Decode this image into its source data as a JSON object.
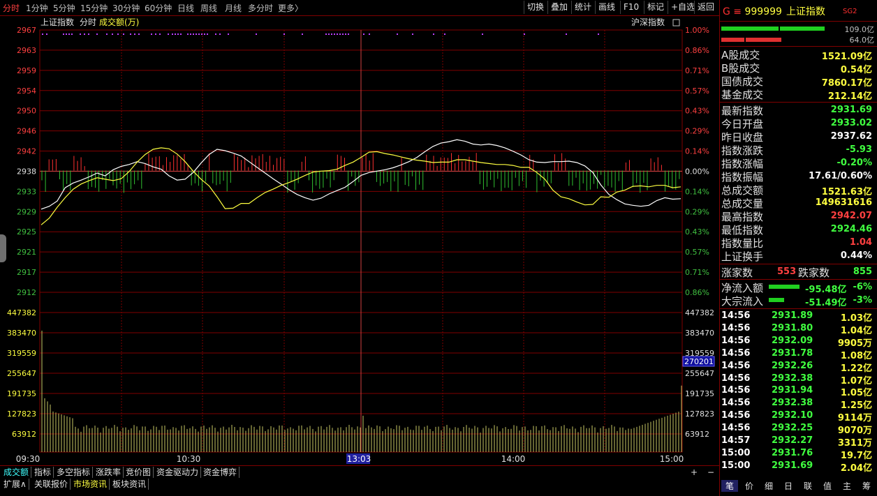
{
  "toolbar": {
    "periods": [
      "分时",
      "1分钟",
      "5分钟",
      "15分钟",
      "30分钟",
      "60分钟",
      "日线",
      "周线",
      "月线",
      "多分时",
      "更多〉"
    ],
    "buttons": [
      "切换",
      "叠加",
      "统计",
      "画线",
      "F10",
      "标记",
      "+自选",
      "返回"
    ]
  },
  "chart_labels": {
    "index_name": "上证指数",
    "mode": "分时",
    "volume_unit": "成交额(万)",
    "overlay": "沪深指数"
  },
  "chart_data": {
    "type": "line",
    "price_ticks": [
      "2967",
      "2963",
      "2959",
      "2954",
      "2950",
      "2946",
      "2942",
      "2938",
      "2933",
      "2929",
      "2925",
      "2921",
      "2917",
      "2912"
    ],
    "pct_ticks": [
      "1.00%",
      "0.86%",
      "0.71%",
      "0.57%",
      "0.43%",
      "0.29%",
      "0.14%",
      "0.00%",
      "0.14%",
      "0.29%",
      "0.43%",
      "0.57%",
      "0.71%",
      "0.86%"
    ],
    "ylim": [
      2912.0,
      2967.2
    ],
    "prev_close": 2937.62,
    "volume_ticks": [
      "447382",
      "383470",
      "319559",
      "255647",
      "191735",
      "127823",
      "63912"
    ],
    "volume_ylim": [
      0,
      447382
    ],
    "x_ticks": [
      "09:30",
      "10:30",
      "13:03",
      "14:00",
      "15:00"
    ],
    "cursor_volume": "270201",
    "series": [
      {
        "values": [
          2929.5,
          2930.1,
          2931.2,
          2934,
          2935,
          2935.6,
          2936.3,
          2937.1,
          2936.5,
          2937.8,
          2938.5,
          2938.9,
          2939.5,
          2939.1,
          2938.4,
          2937.9,
          2936.5,
          2935.6,
          2935.8,
          2937.2,
          2939.2,
          2941,
          2942.1,
          2941.8,
          2941.3,
          2940.7,
          2939.5,
          2938.3,
          2937.1,
          2935.9,
          2934.8,
          2933.6,
          2932.6,
          2931.9,
          2931.4,
          2931.8,
          2932.7,
          2933.4,
          2934.1,
          2935.3,
          2936.6,
          2937.2,
          2937.5,
          2937.8,
          2938.2,
          2938.8,
          2939.5,
          2940.4,
          2941.6,
          2942.7,
          2943.4,
          2943.7,
          2944.1,
          2943.8,
          2943.2,
          2943,
          2943.2,
          2942.9,
          2942.4,
          2941.7,
          2940.9,
          2939.9,
          2939.4,
          2939.3,
          2939.5,
          2939.5,
          2939.6,
          2939.3,
          2938.6,
          2937.2,
          2934.6,
          2932.6,
          2931.5,
          2930.6,
          2930.3,
          2930.1,
          2930.3,
          2931.3,
          2931.9,
          2931.6,
          2931.7
        ]
      },
      {
        "values": [
          2926.2,
          2927.6,
          2929.9,
          2931.9,
          2933.7,
          2934.8,
          2935.5,
          2936.1,
          2935.8,
          2935.5,
          2935.9,
          2937.4,
          2939.4,
          2941,
          2942.1,
          2942.4,
          2942.2,
          2941.1,
          2939.5,
          2937.5,
          2935.8,
          2934.4,
          2932.1,
          2929.6,
          2929.7,
          2930.7,
          2930.7,
          2931.9,
          2933,
          2933.7,
          2934.5,
          2935.1,
          2935.8,
          2936.6,
          2937.3,
          2937.5,
          2937.6,
          2937.9,
          2938.7,
          2939.4,
          2940.4,
          2941.5,
          2941.6,
          2941.2,
          2940.9,
          2940.5,
          2940.1,
          2939.8,
          2939.6,
          2939.3,
          2939.4,
          2939.4,
          2939.9,
          2939.9,
          2939.6,
          2939.3,
          2939.1,
          2938.9,
          2938.9,
          2938.7,
          2938.3,
          2938.3,
          2937.2,
          2935.8,
          2933.5,
          2932.1,
          2931.7,
          2931,
          2930.4,
          2930.5,
          2932.1,
          2932,
          2933.1,
          2933.5,
          2934.3,
          2934.4,
          2934.2,
          2934.5,
          2934.5,
          2934,
          2934.2
        ]
      }
    ]
  },
  "right_panel": {
    "symbol_prefix": "G ≡",
    "code": "999999",
    "name": "上证指数",
    "tag": "SG2",
    "bar_value_1": "109.0亿",
    "bar_value_2": "64.0亿",
    "rows1": [
      {
        "label": "A股成交",
        "value": "1521.09亿"
      },
      {
        "label": "B股成交",
        "value": "0.54亿"
      },
      {
        "label": "国债成交",
        "value": "7860.17亿"
      },
      {
        "label": "基金成交",
        "value": "212.14亿"
      }
    ],
    "rows2": [
      {
        "label": "最新指数",
        "value": "2931.69",
        "color": "#40ff40"
      },
      {
        "label": "今日开盘",
        "value": "2933.02",
        "color": "#40ff40"
      },
      {
        "label": "昨日收盘",
        "value": "2937.62",
        "color": "#ffffff"
      },
      {
        "label": "指数涨跌",
        "value": "-5.93",
        "color": "#40ff40"
      },
      {
        "label": "指数涨幅",
        "value": "-0.20%",
        "color": "#40ff40"
      },
      {
        "label": "指数振幅",
        "value": "17.61/0.60%",
        "color": "#ffffff"
      },
      {
        "label": "总成交额",
        "value": "1521.63亿",
        "color": "#ffff40"
      },
      {
        "label": "总成交量",
        "value": "149631616",
        "color": "#ffff40"
      },
      {
        "label": "最高指数",
        "value": "2942.07",
        "color": "#ff4040"
      },
      {
        "label": "最低指数",
        "value": "2924.46",
        "color": "#40ff40"
      },
      {
        "label": "指数量比",
        "value": "1.04",
        "color": "#ff4040"
      },
      {
        "label": "上证换手",
        "value": "0.44%",
        "color": "#ffffff"
      }
    ],
    "advance_label": "涨家数",
    "advance_value": "553",
    "decline_label": "跌家数",
    "decline_value": "855",
    "flows": [
      {
        "label": "净流入额",
        "value": "-95.48亿",
        "pct": "-6%"
      },
      {
        "label": "大宗流入",
        "value": "-51.49亿",
        "pct": "-3%"
      }
    ],
    "ticks": [
      {
        "time": "14:56",
        "price": "2931.89",
        "amount": "1.03亿"
      },
      {
        "time": "14:56",
        "price": "2931.80",
        "amount": "1.04亿"
      },
      {
        "time": "14:56",
        "price": "2932.09",
        "amount": "9905万"
      },
      {
        "time": "14:56",
        "price": "2931.78",
        "amount": "1.08亿"
      },
      {
        "time": "14:56",
        "price": "2932.26",
        "amount": "1.22亿"
      },
      {
        "time": "14:56",
        "price": "2932.38",
        "amount": "1.07亿"
      },
      {
        "time": "14:56",
        "price": "2931.94",
        "amount": "1.05亿"
      },
      {
        "time": "14:56",
        "price": "2932.38",
        "amount": "1.25亿"
      },
      {
        "time": "14:56",
        "price": "2932.10",
        "amount": "9114万"
      },
      {
        "time": "14:56",
        "price": "2932.25",
        "amount": "9070万"
      },
      {
        "time": "14:57",
        "price": "2932.27",
        "amount": "3311万"
      },
      {
        "time": "15:00",
        "price": "2931.76",
        "amount": "19.7亿"
      },
      {
        "time": "15:00",
        "price": "2931.69",
        "amount": "2.04亿"
      }
    ],
    "tabs": [
      "笔",
      "价",
      "细",
      "日",
      "联",
      "值",
      "主",
      "筹"
    ]
  },
  "bottom_tabs_1": [
    "成交额",
    "指标",
    "多空指标",
    "涨跌率",
    "竞价图",
    "资金驱动力",
    "资金博弈"
  ],
  "bottom_tabs_2": [
    "扩展∧",
    "关联报价",
    "市场资讯",
    "板块资讯"
  ],
  "bottom_right": [
    "+",
    "−"
  ],
  "colors": {
    "grid": "#800000",
    "price_line": "#ffffff",
    "avg_line": "#ffff40",
    "volume_bar": "#c8c864",
    "up": "#ff3030",
    "down": "#30c030"
  }
}
